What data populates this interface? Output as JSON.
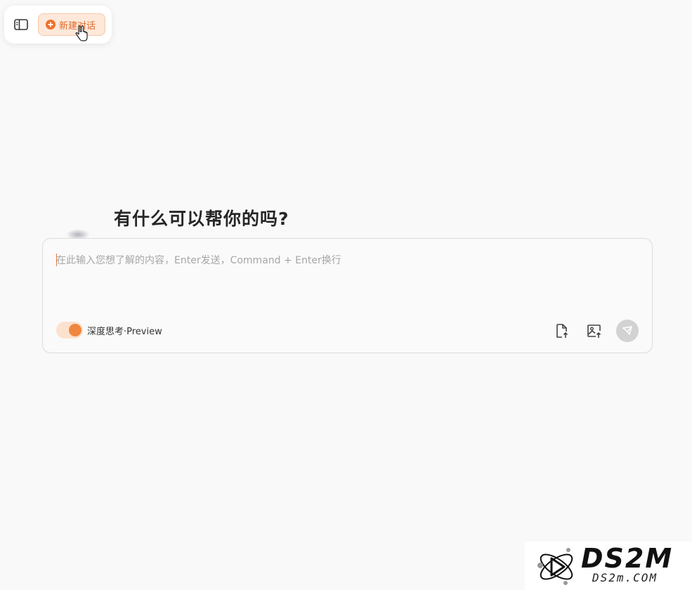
{
  "toolbar": {
    "sidebar_toggle_icon": "sidebar-panel-icon",
    "new_chat_label": "新建对话",
    "new_chat_icon": "plus-circle-icon",
    "accent_color": "#f0702a"
  },
  "main": {
    "heading": "有什么可以帮你的吗?"
  },
  "composer": {
    "placeholder": "在此输入您想了解的内容，Enter发送，Command + Enter换行",
    "value": "",
    "deep_think_label": "深度思考·Preview",
    "deep_think_enabled": true,
    "upload_file_icon": "file-upload-icon",
    "upload_image_icon": "image-upload-icon",
    "send_icon": "send-icon"
  },
  "watermark": {
    "main_text": "DS2M",
    "sub_text": "DS2m.COM"
  }
}
